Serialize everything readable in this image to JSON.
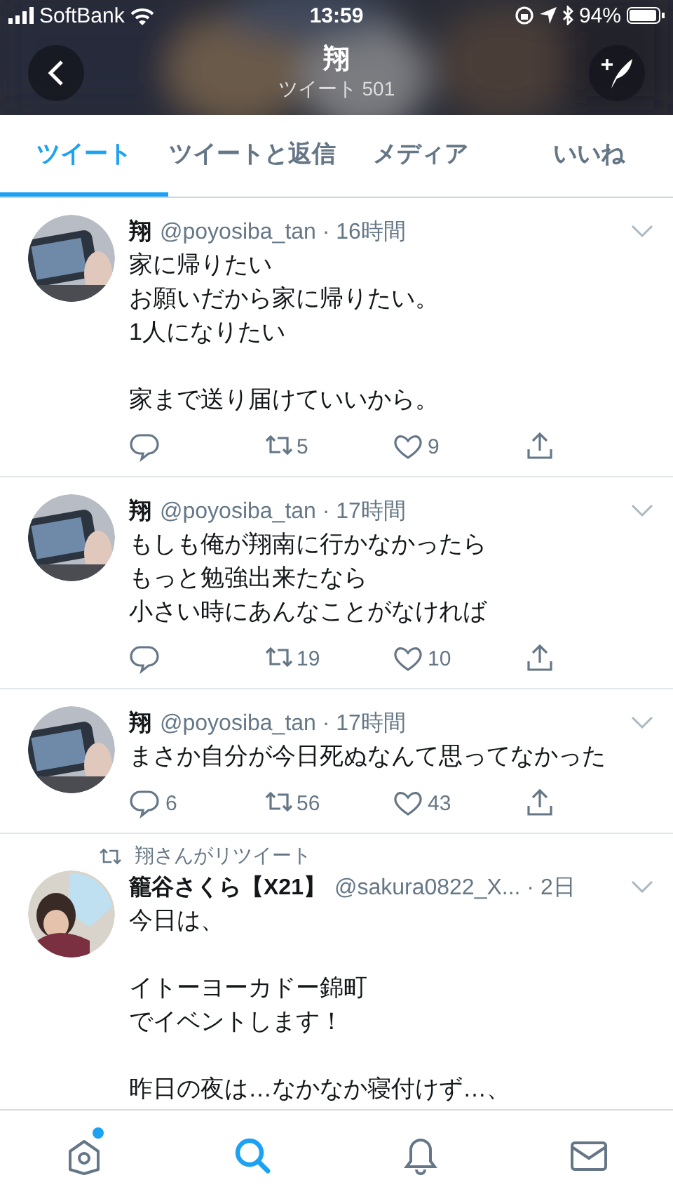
{
  "status_bar": {
    "carrier": "SoftBank",
    "time": "13:59",
    "battery": "94%"
  },
  "header": {
    "title": "翔",
    "subtitle": "ツイート 501"
  },
  "tabs": [
    {
      "label": "ツイート",
      "selected": true
    },
    {
      "label": "ツイートと返信",
      "selected": false
    },
    {
      "label": "メディア",
      "selected": false
    },
    {
      "label": "いいね",
      "selected": false
    }
  ],
  "tweets": [
    {
      "name": "翔",
      "meta": "@poyosiba_tan · 16時間",
      "paragraphs": [
        [
          "家に帰りたい",
          "お願いだから家に帰りたい。",
          "1人になりたい"
        ],
        [
          "家まで送り届けていいから。"
        ]
      ],
      "retweets": "5",
      "likes": "9"
    },
    {
      "name": "翔",
      "meta": "@poyosiba_tan · 17時間",
      "paragraphs": [
        [
          "もしも俺が翔南に行かなかったら",
          "もっと勉強出来たなら",
          "小さい時にあんなことがなければ"
        ]
      ],
      "retweets": "19",
      "likes": "10"
    },
    {
      "name": "翔",
      "meta": "@poyosiba_tan · 17時間",
      "paragraphs": [
        [
          "まさか自分が今日死ぬなんて思ってなかった"
        ]
      ],
      "replies": "6",
      "retweets": "56",
      "likes": "43"
    },
    {
      "retweeted_by": "翔さんがリツイート",
      "name": "籠谷さくら【X21】",
      "meta": "@sakura0822_X... · 2日",
      "paragraphs": [
        [
          "今日は、"
        ],
        [
          "イトーヨーカドー錦町",
          "でイベントします！"
        ],
        [
          "昨日の夜は…なかなか寝付けず…、"
        ]
      ]
    }
  ],
  "nav": [
    {
      "kind": "home",
      "selected": false,
      "dot": true
    },
    {
      "kind": "search",
      "selected": true,
      "dot": false
    },
    {
      "kind": "bell",
      "selected": false,
      "dot": false
    },
    {
      "kind": "mail",
      "selected": false,
      "dot": false
    }
  ]
}
